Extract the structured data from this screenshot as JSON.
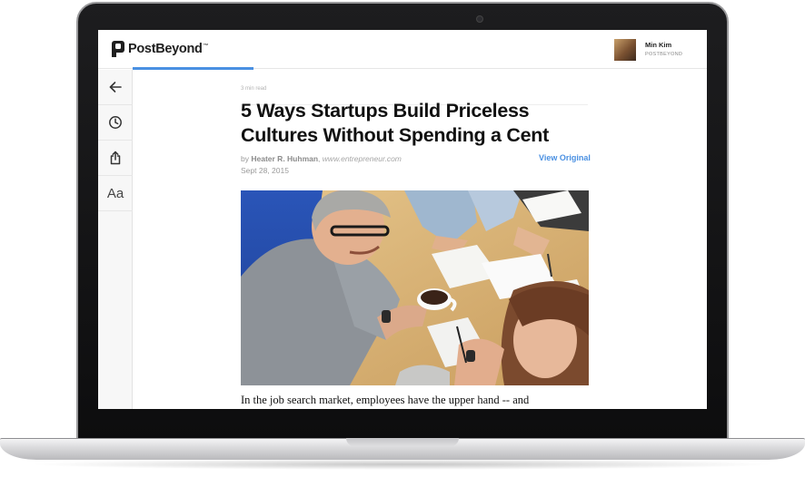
{
  "app": {
    "logo_text": "PostBeyond",
    "logo_trademark": "™"
  },
  "user": {
    "name": "Min Kim",
    "org": "POSTBEYOND"
  },
  "reading_progress": 0.21,
  "sidebar": {
    "items": [
      {
        "icon": "back-arrow-icon"
      },
      {
        "icon": "clock-icon"
      },
      {
        "icon": "share-icon"
      },
      {
        "icon": "font-size-icon",
        "label": "Aa"
      }
    ]
  },
  "article": {
    "read_time": "3 min read",
    "title": "5 Ways Startups Build Priceless Cultures Without Spending a Cent",
    "by_prefix": "by",
    "author": "Heater R. Huhman",
    "separator": ",",
    "source": "www.entrepreneur.com",
    "date": "Sept 28, 2015",
    "view_original_label": "View Original",
    "first_line": "In the job search market, employees have the upper hand -- and"
  },
  "colors": {
    "accent": "#4a90e2",
    "title_text": "#111111",
    "meta_text": "#9a9a9a"
  }
}
